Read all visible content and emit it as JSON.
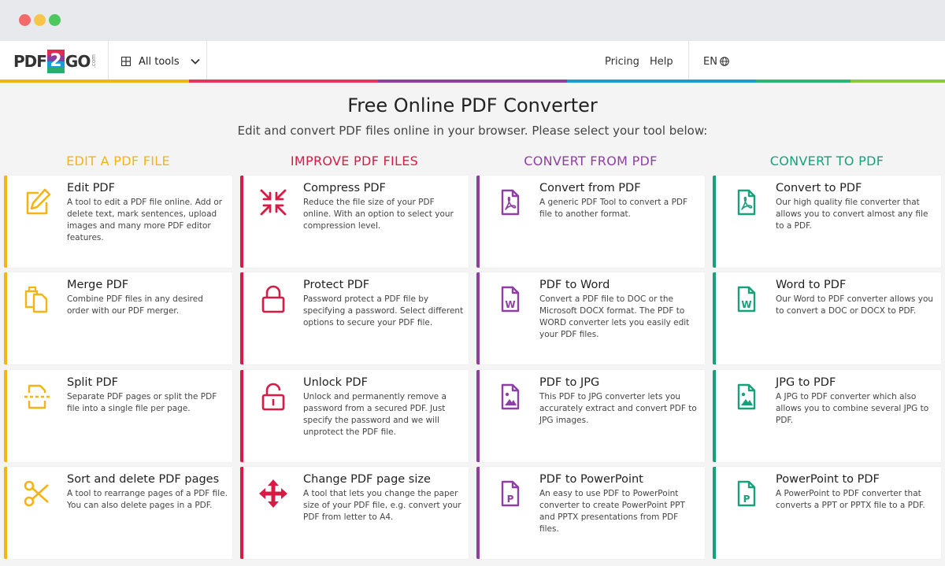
{
  "window": {
    "dots": [
      "#f26b6b",
      "#f7c549",
      "#4fc75f"
    ]
  },
  "nav": {
    "logo": {
      "pdf": "PDF",
      "two": "2",
      "go": "GO",
      "com": ".com"
    },
    "all_tools": "All tools",
    "pricing": "Pricing",
    "help": "Help",
    "lang": "EN"
  },
  "hero": {
    "title": "Free Online PDF Converter",
    "subtitle": "Edit and convert PDF files online in your browser. Please select your tool below:"
  },
  "stripe_colors": [
    "#f5b414",
    "#f5b414",
    "#e8345c",
    "#e8345c",
    "#8e3fa3",
    "#8e3fa3",
    "#1d9ad6",
    "#1d9ad6",
    "#2bb673",
    "#8dc63f"
  ],
  "columns": [
    {
      "heading": "EDIT A PDF FILE",
      "color": "#f5b414",
      "cards": [
        {
          "title": "Edit PDF",
          "desc": "A tool to edit a PDF file online. Add or delete text, mark sentences, upload images and many more PDF editor features.",
          "icon": "edit-icon"
        },
        {
          "title": "Merge PDF",
          "desc": "Combine PDF files in any desired order with our PDF merger.",
          "icon": "merge-icon"
        },
        {
          "title": "Split PDF",
          "desc": "Separate PDF pages or split the PDF file into a single file per page.",
          "icon": "split-icon"
        },
        {
          "title": "Sort and delete PDF pages",
          "desc": "A tool to rearrange pages of a PDF file. You can also delete pages in a PDF.",
          "icon": "scissors-icon"
        }
      ]
    },
    {
      "heading": "IMPROVE PDF FILES",
      "color": "#d81b45",
      "cards": [
        {
          "title": "Compress PDF",
          "desc": "Reduce the file size of your PDF online. With an option to select your compression level.",
          "icon": "compress-icon"
        },
        {
          "title": "Protect PDF",
          "desc": "Password protect a PDF file by specifying a password. Select different options to secure your PDF file.",
          "icon": "lock-icon"
        },
        {
          "title": "Unlock PDF",
          "desc": "Unlock and permanently remove a password from a secured PDF. Just specify the password and we will unprotect the PDF file.",
          "icon": "unlock-icon"
        },
        {
          "title": "Change PDF page size",
          "desc": "A tool that lets you change the paper size of your PDF file, e.g. convert your PDF from letter to A4.",
          "icon": "resize-arrows-icon"
        }
      ]
    },
    {
      "heading": "CONVERT FROM PDF",
      "color": "#8e3fa3",
      "cards": [
        {
          "title": "Convert from PDF",
          "desc": "A generic PDF Tool to convert a PDF file to another format.",
          "icon": "pdf-file-icon"
        },
        {
          "title": "PDF to Word",
          "desc": "Convert a PDF file to DOC or the Microsoft DOCX format. The PDF to WORD converter lets you easily edit your PDF files.",
          "icon": "word-file-icon"
        },
        {
          "title": "PDF to JPG",
          "desc": "This PDF to JPG converter lets you accurately extract and convert PDF to JPG images.",
          "icon": "image-file-icon"
        },
        {
          "title": "PDF to PowerPoint",
          "desc": "An easy to use PDF to PowerPoint converter to create PowerPoint PPT and PPTX presentations from PDF files.",
          "icon": "powerpoint-file-icon"
        }
      ]
    },
    {
      "heading": "CONVERT TO PDF",
      "color": "#16a17a",
      "cards": [
        {
          "title": "Convert to PDF",
          "desc": "Our high quality file converter that allows you to convert almost any file to a PDF.",
          "icon": "pdf-file-icon"
        },
        {
          "title": "Word to PDF",
          "desc": "Our Word to PDF converter allows you to convert a DOC or DOCX to PDF.",
          "icon": "word-file-icon"
        },
        {
          "title": "JPG to PDF",
          "desc": "A JPG to PDF converter which also allows you to combine several JPG to PDF.",
          "icon": "image-file-icon"
        },
        {
          "title": "PowerPoint to PDF",
          "desc": "A PowerPoint to PDF converter that converts a PPT or PPTX file to a PDF.",
          "icon": "powerpoint-file-icon"
        }
      ]
    }
  ]
}
